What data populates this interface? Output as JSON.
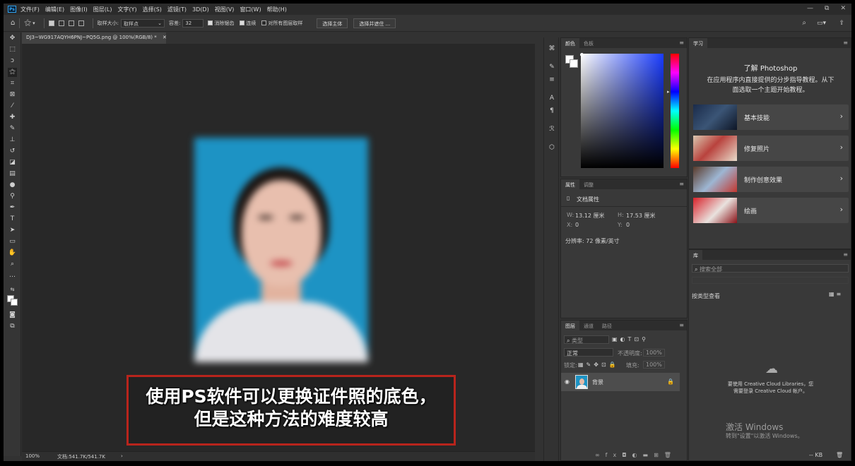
{
  "app_logo": "Ps",
  "menu": [
    "文件(F)",
    "编辑(E)",
    "图像(I)",
    "图层(L)",
    "文字(Y)",
    "选择(S)",
    "滤镜(T)",
    "3D(D)",
    "视图(V)",
    "窗口(W)",
    "帮助(H)"
  ],
  "window_controls": [
    "—",
    "⧉",
    "✕"
  ],
  "options": {
    "sample_size_label": "取样大小:",
    "sample_size_value": "取样点",
    "tolerance_label": "容差:",
    "tolerance_value": "32",
    "antialias_label": "消除锯齿",
    "contiguous_label": "连续",
    "sample_all_label": "对所有图层取样",
    "select_subject_btn": "选择主体",
    "select_mask_btn": "选择并遮住 ..."
  },
  "document": {
    "tab_title": "DJ3~WG917AQYH6PNJ~PQ5G.png @ 100%(RGB/8) *",
    "zoom": "100%",
    "doc_size": "文档:541.7K/541.7K"
  },
  "subtitle": {
    "line1": "使用PS软件可以更换证件照的底色，",
    "line2": "但是这种方法的难度较高"
  },
  "color_panel": {
    "tabs": [
      "颜色",
      "色板"
    ],
    "fg_color": "#ffffff",
    "bg_color": "#ffffff"
  },
  "properties_panel": {
    "tabs": [
      "属性",
      "调整"
    ],
    "header": "文档属性",
    "w_label": "W:",
    "w_value": "13.12 厘米",
    "h_label": "H:",
    "h_value": "17.53 厘米",
    "x_label": "X:",
    "x_value": "0",
    "y_label": "Y:",
    "y_value": "0",
    "resolution": "分辨率: 72 像素/英寸"
  },
  "layers_panel": {
    "tabs": [
      "图层",
      "通道",
      "路径"
    ],
    "kind_placeholder": "类型",
    "blend_mode": "正常",
    "opacity_label": "不透明度:",
    "opacity_value": "100%",
    "lock_label": "锁定:",
    "fill_label": "填充:",
    "fill_value": "100%",
    "layer_name": "背景"
  },
  "learn_panel": {
    "tab": "学习",
    "title": "了解 Photoshop",
    "description_line1": "在应用程序内直接提供的分步指导教程。从下",
    "description_line2": "面选取一个主题开始教程。",
    "cards": [
      {
        "label": "基本技能"
      },
      {
        "label": "修复照片"
      },
      {
        "label": "制作创意效果"
      },
      {
        "label": "绘画"
      }
    ]
  },
  "libraries_panel": {
    "tab": "库",
    "search_placeholder": "搜索全部",
    "view_label": "按类型查看",
    "cc_line1": "要使用 Creative Cloud Libraries，您",
    "cc_line2": "需要登录 Creative Cloud 帐户。",
    "kb_label": "-- KB"
  },
  "windows_activation": {
    "title": "激活 Windows",
    "subtitle": "转到\"设置\"以激活 Windows。"
  }
}
